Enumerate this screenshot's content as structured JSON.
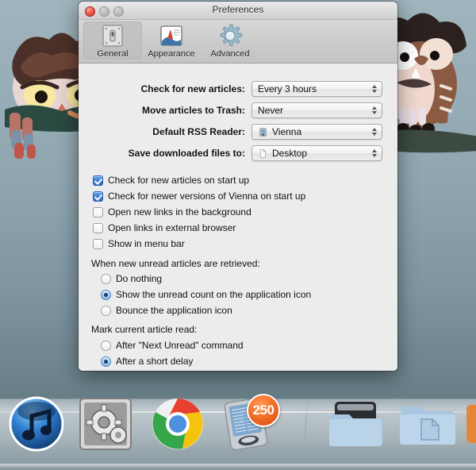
{
  "window": {
    "title": "Preferences",
    "traffic_lights": [
      "close",
      "minimize",
      "zoom"
    ]
  },
  "toolbar": {
    "items": [
      {
        "label": "General",
        "icon": "light-switch-icon",
        "selected": true
      },
      {
        "label": "Appearance",
        "icon": "appearance-icon",
        "selected": false
      },
      {
        "label": "Advanced",
        "icon": "gear-icon",
        "selected": false
      }
    ]
  },
  "settings_rows": [
    {
      "label": "Check for new articles:",
      "value": "Every 3 hours",
      "icon": null
    },
    {
      "label": "Move articles to Trash:",
      "value": "Never",
      "icon": null
    },
    {
      "label": "Default RSS Reader:",
      "value": "Vienna",
      "icon": "vienna-app-icon"
    },
    {
      "label": "Save downloaded files to:",
      "value": "Desktop",
      "icon": "folder-icon"
    }
  ],
  "checkboxes": [
    {
      "label": "Check for new articles on start up",
      "checked": true
    },
    {
      "label": "Check for newer versions of Vienna on start up",
      "checked": true
    },
    {
      "label": "Open new links in the background",
      "checked": false
    },
    {
      "label": "Open links in external browser",
      "checked": false
    },
    {
      "label": "Show in menu bar",
      "checked": false
    }
  ],
  "radio_groups": [
    {
      "heading": "When new unread articles are retrieved:",
      "options": [
        {
          "label": "Do nothing",
          "selected": false
        },
        {
          "label": "Show the unread count on the application icon",
          "selected": true
        },
        {
          "label": "Bounce the application icon",
          "selected": false
        }
      ]
    },
    {
      "heading": "Mark current article read:",
      "options": [
        {
          "label": "After \"Next Unread\" command",
          "selected": false
        },
        {
          "label": "After a short delay",
          "selected": true
        }
      ]
    }
  ],
  "dock": {
    "items": [
      {
        "name": "itunes",
        "label": "iTunes",
        "badge": null
      },
      {
        "name": "system-preferences",
        "label": "System Preferences",
        "badge": null
      },
      {
        "name": "google-chrome",
        "label": "Google Chrome",
        "badge": null
      },
      {
        "name": "vienna",
        "label": "Vienna",
        "badge": "250"
      },
      {
        "name": "downloads-stack",
        "label": "Downloads",
        "badge": null
      },
      {
        "name": "documents-folder",
        "label": "Documents",
        "badge": null
      }
    ]
  },
  "desktop": {
    "wallpaper": "owls-illustration",
    "accent_color": "#3d7fd4",
    "badge_color": "#f3702a"
  }
}
